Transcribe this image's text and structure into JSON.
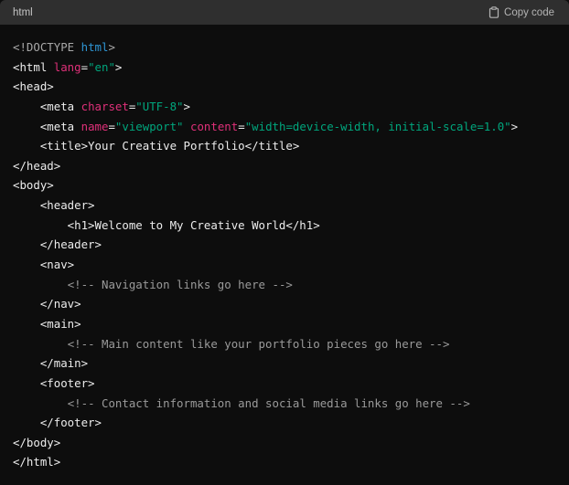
{
  "header": {
    "language": "html",
    "copy_label": "Copy code",
    "copy_icon": "clipboard-icon"
  },
  "colors": {
    "plain": "#ececec",
    "doctype": "#a8a8a8",
    "keyword": "#2e95d3",
    "attribute": "#df3079",
    "string": "#00a67d",
    "comment": "#9a9a9a",
    "background": "#0d0d0d",
    "header_background": "#2f2f2f"
  },
  "code_lines": [
    [
      [
        "doctype",
        "<!DOCTYPE "
      ],
      [
        "keyword",
        "html"
      ],
      [
        "doctype",
        ">"
      ]
    ],
    [
      [
        "plain",
        "<html "
      ],
      [
        "attr",
        "lang"
      ],
      [
        "plain",
        "="
      ],
      [
        "string",
        "\"en\""
      ],
      [
        "plain",
        ">"
      ]
    ],
    [
      [
        "plain",
        "<head>"
      ]
    ],
    [
      [
        "plain",
        "    <meta "
      ],
      [
        "attr",
        "charset"
      ],
      [
        "plain",
        "="
      ],
      [
        "string",
        "\"UTF-8\""
      ],
      [
        "plain",
        ">"
      ]
    ],
    [
      [
        "plain",
        "    <meta "
      ],
      [
        "attr",
        "name"
      ],
      [
        "plain",
        "="
      ],
      [
        "string",
        "\"viewport\""
      ],
      [
        "plain",
        " "
      ],
      [
        "attr",
        "content"
      ],
      [
        "plain",
        "="
      ],
      [
        "string",
        "\"width=device-width, initial-scale=1.0\""
      ],
      [
        "plain",
        ">"
      ]
    ],
    [
      [
        "plain",
        "    <title>Your Creative Portfolio</title>"
      ]
    ],
    [
      [
        "plain",
        "</head>"
      ]
    ],
    [
      [
        "plain",
        "<body>"
      ]
    ],
    [
      [
        "plain",
        "    <header>"
      ]
    ],
    [
      [
        "plain",
        "        <h1>Welcome to My Creative World</h1>"
      ]
    ],
    [
      [
        "plain",
        "    </header>"
      ]
    ],
    [
      [
        "plain",
        "    <nav>"
      ]
    ],
    [
      [
        "plain",
        "        "
      ],
      [
        "comment",
        "<!-- Navigation links go here -->"
      ]
    ],
    [
      [
        "plain",
        "    </nav>"
      ]
    ],
    [
      [
        "plain",
        "    <main>"
      ]
    ],
    [
      [
        "plain",
        "        "
      ],
      [
        "comment",
        "<!-- Main content like your portfolio pieces go here -->"
      ]
    ],
    [
      [
        "plain",
        "    </main>"
      ]
    ],
    [
      [
        "plain",
        "    <footer>"
      ]
    ],
    [
      [
        "plain",
        "        "
      ],
      [
        "comment",
        "<!-- Contact information and social media links go here -->"
      ]
    ],
    [
      [
        "plain",
        "    </footer>"
      ]
    ],
    [
      [
        "plain",
        "</body>"
      ]
    ],
    [
      [
        "plain",
        "</html>"
      ]
    ]
  ]
}
